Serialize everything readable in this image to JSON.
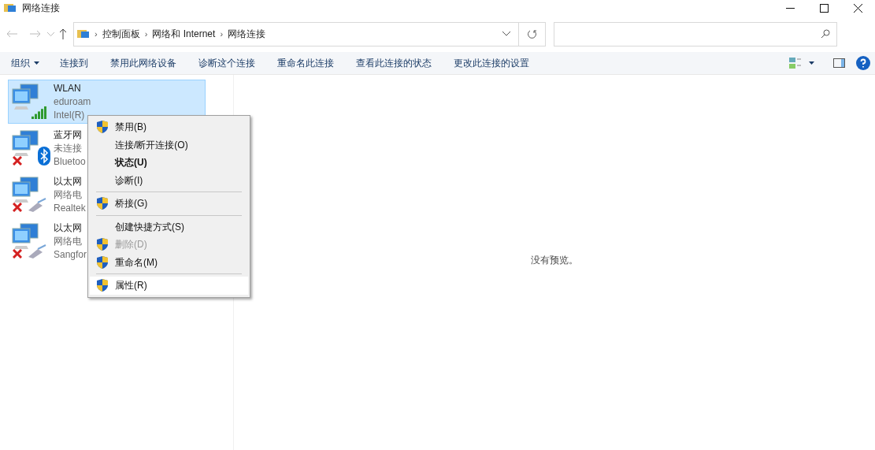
{
  "window": {
    "title": "网络连接"
  },
  "address_bar": {
    "path": [
      {
        "separator": "›",
        "label": "控制面板"
      },
      {
        "separator": "›",
        "label": "网络和 Internet"
      },
      {
        "separator": "›",
        "label": "网络连接"
      }
    ]
  },
  "toolbar": {
    "items": [
      {
        "label": "组织",
        "dropdown": true
      },
      {
        "label": "连接到",
        "dropdown": false
      },
      {
        "label": "禁用此网络设备",
        "dropdown": false
      },
      {
        "label": "诊断这个连接",
        "dropdown": false
      },
      {
        "label": "重命名此连接",
        "dropdown": false
      },
      {
        "label": "查看此连接的状态",
        "dropdown": false
      },
      {
        "label": "更改此连接的设置",
        "dropdown": false
      }
    ]
  },
  "connections": [
    {
      "name": "WLAN",
      "status": "eduroam",
      "device": "Intel(R)",
      "kind": "wifi",
      "disconnected": false,
      "selected": true
    },
    {
      "name": "蓝牙网",
      "status": "未连接",
      "device": "Bluetoo",
      "kind": "bluetooth",
      "disconnected": true,
      "selected": false
    },
    {
      "name": "以太网",
      "status": "网络电",
      "device": "Realtek",
      "kind": "ethernet",
      "disconnected": true,
      "selected": false
    },
    {
      "name": "以太网",
      "status": "网络电",
      "device": "Sangfor",
      "kind": "ethernet",
      "disconnected": true,
      "selected": false
    }
  ],
  "context_menu": {
    "items": [
      {
        "kind": "item",
        "label": "禁用(B)",
        "shield": true,
        "bold": false,
        "disabled": false,
        "selected": false
      },
      {
        "kind": "item",
        "label": "连接/断开连接(O)",
        "shield": false,
        "bold": false,
        "disabled": false,
        "selected": false
      },
      {
        "kind": "item",
        "label": "状态(U)",
        "shield": false,
        "bold": true,
        "disabled": false,
        "selected": false
      },
      {
        "kind": "item",
        "label": "诊断(I)",
        "shield": false,
        "bold": false,
        "disabled": false,
        "selected": false
      },
      {
        "kind": "separator"
      },
      {
        "kind": "item",
        "label": "桥接(G)",
        "shield": true,
        "bold": false,
        "disabled": false,
        "selected": false
      },
      {
        "kind": "separator"
      },
      {
        "kind": "item",
        "label": "创建快捷方式(S)",
        "shield": false,
        "bold": false,
        "disabled": false,
        "selected": false
      },
      {
        "kind": "item",
        "label": "删除(D)",
        "shield": true,
        "bold": false,
        "disabled": true,
        "selected": false
      },
      {
        "kind": "item",
        "label": "重命名(M)",
        "shield": true,
        "bold": false,
        "disabled": false,
        "selected": false
      },
      {
        "kind": "separator"
      },
      {
        "kind": "item",
        "label": "属性(R)",
        "shield": true,
        "bold": false,
        "disabled": false,
        "selected": true
      }
    ]
  },
  "preview": {
    "text": "没有预览。"
  }
}
